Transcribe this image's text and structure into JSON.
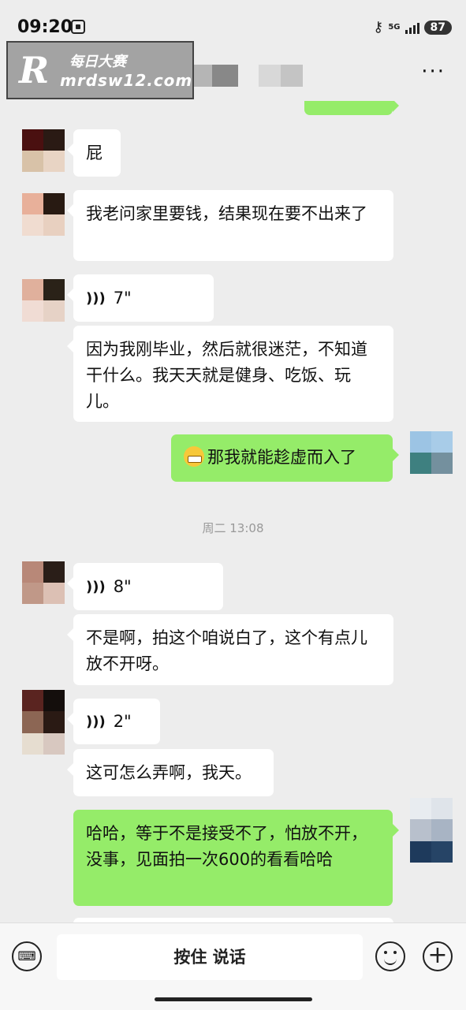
{
  "status_bar": {
    "time": "09:20",
    "network": "5G",
    "battery": "87"
  },
  "watermark": {
    "title": "每日大赛",
    "url": "mrdsw12.com"
  },
  "nav": {
    "back_glyph": "‹",
    "more_glyph": "···"
  },
  "messages": [
    {
      "side": "out",
      "text": ""
    },
    {
      "side": "in",
      "type": "text",
      "text": "屁"
    },
    {
      "side": "in",
      "type": "text",
      "text": "我老问家里要钱，结果现在要不出来了"
    },
    {
      "side": "in",
      "type": "voice",
      "duration": "7\""
    },
    {
      "side": "in",
      "type": "text",
      "text": "因为我刚毕业，然后就很迷茫，不知道干什么。我天天就是健身、吃饭、玩儿。"
    },
    {
      "side": "out",
      "type": "text",
      "emoji": "grin-emoji",
      "text": "那我就能趁虚而入了"
    },
    {
      "side": "in",
      "type": "voice",
      "duration": "8\""
    },
    {
      "side": "in",
      "type": "text",
      "text": "不是啊，拍这个咱说白了，这个有点儿放不开呀。"
    },
    {
      "side": "in",
      "type": "voice",
      "duration": "2\""
    },
    {
      "side": "in",
      "type": "text",
      "text": "这可怎么弄啊，我天。"
    },
    {
      "side": "out",
      "type": "text",
      "text": "哈哈，等于不是接受不了，怕放不开，没事，见面拍一次600的看看哈哈"
    }
  ],
  "timestamp": "周二 13:08",
  "voice_icon": ")))",
  "bottom_bar": {
    "keyboard_icon": "keyboard-icon",
    "hold_to_talk": "按住 说话",
    "plus_glyph": "+"
  },
  "colors": {
    "background": "#ededed",
    "bubble_in": "#ffffff",
    "bubble_out": "#95ec69"
  }
}
